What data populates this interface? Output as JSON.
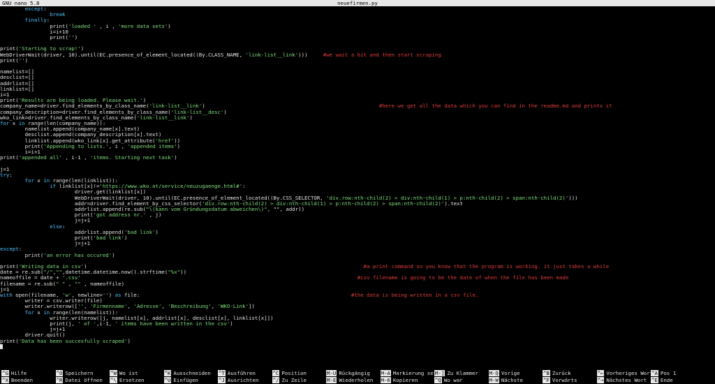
{
  "titlebar": {
    "app": "GNU nano 5.8",
    "filename": "neuefirmen.py"
  },
  "editor": {
    "lines": [
      {
        "y": 0,
        "segs": [
          [
            "n",
            "        "
          ],
          [
            "k",
            "except"
          ],
          [
            "n",
            ":"
          ]
        ]
      },
      {
        "y": 1,
        "segs": [
          [
            "n",
            "                "
          ],
          [
            "k",
            "break"
          ]
        ]
      },
      {
        "y": 2,
        "segs": [
          [
            "n",
            "        "
          ],
          [
            "k",
            "finally"
          ],
          [
            "n",
            ":"
          ]
        ]
      },
      {
        "y": 3,
        "segs": [
          [
            "n",
            "                print("
          ],
          [
            "s",
            "'loaded ' "
          ],
          [
            "n",
            ", i , "
          ],
          [
            "s",
            "'more data sets'"
          ],
          [
            "n",
            ")"
          ]
        ]
      },
      {
        "y": 4,
        "segs": [
          [
            "n",
            "                i=i+10"
          ]
        ]
      },
      {
        "y": 5,
        "segs": [
          [
            "n",
            "                print("
          ],
          [
            "s",
            "''"
          ],
          [
            "n",
            ")"
          ]
        ]
      },
      {
        "y": 7,
        "segs": [
          [
            "n",
            "print("
          ],
          [
            "s",
            "'Starting to scrap!'"
          ],
          [
            "n",
            ")"
          ]
        ]
      },
      {
        "y": 8,
        "segs": [
          [
            "n",
            "WebDriverWait(driver, 10).until(EC.presence_of_element_located((By.CLASS_NAME, "
          ],
          [
            "s",
            "'link-list__link'"
          ],
          [
            "n",
            ")))     "
          ],
          [
            "c",
            "#we wait a bit and then start scraping"
          ]
        ]
      },
      {
        "y": 9,
        "segs": [
          [
            "n",
            "print("
          ],
          [
            "s",
            "''"
          ],
          [
            "n",
            ")"
          ]
        ]
      },
      {
        "y": 11,
        "segs": [
          [
            "n",
            "namelist=[]"
          ]
        ]
      },
      {
        "y": 12,
        "segs": [
          [
            "n",
            "desclist=[]"
          ]
        ]
      },
      {
        "y": 13,
        "segs": [
          [
            "n",
            "addrlist=[]"
          ]
        ]
      },
      {
        "y": 14,
        "segs": [
          [
            "n",
            "linklist=[]"
          ]
        ]
      },
      {
        "y": 15,
        "segs": [
          [
            "n",
            "i=1"
          ]
        ]
      },
      {
        "y": 16,
        "segs": [
          [
            "n",
            "print("
          ],
          [
            "s",
            "'Results are being loaded. Please wait.'"
          ],
          [
            "n",
            ")"
          ]
        ]
      },
      {
        "y": 17,
        "segs": [
          [
            "n",
            "company_name=driver.find_elements_by_class_name("
          ],
          [
            "s",
            "'link-list__link'"
          ],
          [
            "n",
            ")                                                        "
          ],
          [
            "c",
            "#here we get all the data which you can find in the readme.md and prints it"
          ]
        ]
      },
      {
        "y": 18,
        "segs": [
          [
            "n",
            "company_description=driver.find_elements_by_class_name("
          ],
          [
            "s",
            "'link-list__desc'"
          ],
          [
            "n",
            ")"
          ]
        ]
      },
      {
        "y": 19,
        "segs": [
          [
            "n",
            "wko_link=driver.find_elements_by_class_name("
          ],
          [
            "s",
            "'link-list__link'"
          ],
          [
            "n",
            ")"
          ]
        ]
      },
      {
        "y": 20,
        "segs": [
          [
            "k",
            "for"
          ],
          [
            "n",
            " x "
          ],
          [
            "k",
            "in"
          ],
          [
            "n",
            " range(len(company_name)):"
          ]
        ]
      },
      {
        "y": 21,
        "segs": [
          [
            "n",
            "        namelist.append(company_name[x].text)"
          ]
        ]
      },
      {
        "y": 22,
        "segs": [
          [
            "n",
            "        desclist.append(company_description[x].text)"
          ]
        ]
      },
      {
        "y": 23,
        "segs": [
          [
            "n",
            "        linklist.append(wko_link[x].get_attribute("
          ],
          [
            "s",
            "'href'"
          ],
          [
            "n",
            "))"
          ]
        ]
      },
      {
        "y": 24,
        "segs": [
          [
            "n",
            "        print("
          ],
          [
            "s",
            "'Appending to lists.'"
          ],
          [
            "n",
            ", i , "
          ],
          [
            "s",
            "'appended items'"
          ],
          [
            "n",
            ")"
          ]
        ]
      },
      {
        "y": 25,
        "segs": [
          [
            "n",
            "        i=i+1"
          ]
        ]
      },
      {
        "y": 26,
        "segs": [
          [
            "n",
            "print("
          ],
          [
            "s",
            "'appended all'"
          ],
          [
            "n",
            " , i-1 , "
          ],
          [
            "s",
            "'items. Starting next task'"
          ],
          [
            "n",
            ")"
          ]
        ]
      },
      {
        "y": 28,
        "segs": [
          [
            "n",
            "j=1"
          ]
        ]
      },
      {
        "y": 29,
        "segs": [
          [
            "k",
            "try"
          ],
          [
            "n",
            ":"
          ]
        ]
      },
      {
        "y": 30,
        "segs": [
          [
            "n",
            "        "
          ],
          [
            "k",
            "for"
          ],
          [
            "n",
            " x "
          ],
          [
            "k",
            "in"
          ],
          [
            "n",
            " range(len(linklist)):"
          ]
        ]
      },
      {
        "y": 31,
        "segs": [
          [
            "n",
            "                "
          ],
          [
            "k",
            "if"
          ],
          [
            "n",
            " linklist[x]!="
          ],
          [
            "s",
            "'https://www.wko.at/service/neuzugaenge.html#'"
          ],
          [
            "n",
            ":"
          ]
        ]
      },
      {
        "y": 32,
        "segs": [
          [
            "n",
            "                        driver.get(linklist[x])"
          ]
        ]
      },
      {
        "y": 33,
        "segs": [
          [
            "n",
            "                        WebDriverWait(driver, 10).until(EC.presence_of_element_located((By.CSS_SELECTOR, "
          ],
          [
            "s",
            "'div.row:nth-child(2) > div:nth-child(1) > p:nth-child(2) > span:nth-child(2)'"
          ],
          [
            "n",
            ")))"
          ]
        ]
      },
      {
        "y": 34,
        "segs": [
          [
            "n",
            "                        addr=driver.find_element_by_css_selector("
          ],
          [
            "s",
            "'div.row:nth-child(2) > div:nth-child(1) > p:nth-child(2) > span:nth-child(2)'"
          ],
          [
            "n",
            ").text"
          ]
        ]
      },
      {
        "y": 35,
        "segs": [
          [
            "n",
            "                        addrlist.append(re.sub("
          ],
          [
            "s",
            "\"\\(kann vom Gründungsdatum abweichen\\)\""
          ],
          [
            "n",
            ", \"\", addr))"
          ]
        ]
      },
      {
        "y": 36,
        "segs": [
          [
            "n",
            "                        print("
          ],
          [
            "s",
            "'got address nr.'"
          ],
          [
            "n",
            " , j)"
          ]
        ]
      },
      {
        "y": 37,
        "segs": [
          [
            "n",
            "                        j=j+1"
          ]
        ]
      },
      {
        "y": 38,
        "segs": [
          [
            "n",
            "                "
          ],
          [
            "k",
            "else"
          ],
          [
            "n",
            ":"
          ]
        ]
      },
      {
        "y": 39,
        "segs": [
          [
            "n",
            "                        addrlist.append("
          ],
          [
            "s",
            "'bad link'"
          ],
          [
            "n",
            ")"
          ]
        ]
      },
      {
        "y": 40,
        "segs": [
          [
            "n",
            "                        print("
          ],
          [
            "s",
            "'bad link'"
          ],
          [
            "n",
            ")"
          ]
        ]
      },
      {
        "y": 41,
        "segs": [
          [
            "n",
            "                        j=j+1"
          ]
        ]
      },
      {
        "y": 42,
        "segs": [
          [
            "k",
            "except"
          ],
          [
            "n",
            ":"
          ]
        ]
      },
      {
        "y": 43,
        "segs": [
          [
            "n",
            "        print("
          ],
          [
            "s",
            "'an error has occured'"
          ],
          [
            "n",
            ")"
          ]
        ]
      },
      {
        "y": 45,
        "segs": [
          [
            "n",
            "print("
          ],
          [
            "s",
            "'Writing data in csv'"
          ],
          [
            "n",
            ")                                                                                         "
          ],
          [
            "c",
            "#a print command so you know that the program is working. it just takes a while"
          ]
        ]
      },
      {
        "y": 46,
        "segs": [
          [
            "n",
            "date = re.sub("
          ],
          [
            "s",
            "\"/\""
          ],
          [
            "n",
            ","
          ],
          [
            "s",
            "\"\""
          ],
          [
            "n",
            ",datetime.datetime.now().strftime("
          ],
          [
            "s",
            "\"%x\""
          ],
          [
            "n",
            "))"
          ]
        ]
      },
      {
        "y": 47,
        "segs": [
          [
            "n",
            "nameoffile = date + "
          ],
          [
            "s",
            "'.csv'"
          ],
          [
            "n",
            "                                                                                         "
          ],
          [
            "c",
            "#csv filename is going to be the date of when the file has been made"
          ]
        ]
      },
      {
        "y": 48,
        "segs": [
          [
            "n",
            "filename = re.sub("
          ],
          [
            "s",
            "\" \""
          ],
          [
            "n",
            " , "
          ],
          [
            "s",
            "\"\""
          ],
          [
            "n",
            " , nameoffile)"
          ]
        ]
      },
      {
        "y": 49,
        "segs": [
          [
            "n",
            "j=1"
          ]
        ]
      },
      {
        "y": 50,
        "segs": [
          [
            "k",
            "with"
          ],
          [
            "n",
            " open(filename, "
          ],
          [
            "s",
            "'w'"
          ],
          [
            "n",
            ", newline="
          ],
          [
            "s",
            "''"
          ],
          [
            "n",
            ") "
          ],
          [
            "k",
            "as"
          ],
          [
            "n",
            " file:                                                                    "
          ],
          [
            "c",
            "#the data is being written in a csv file."
          ]
        ]
      },
      {
        "y": 51,
        "segs": [
          [
            "n",
            "        writer = csv.writer(file)"
          ]
        ]
      },
      {
        "y": 52,
        "segs": [
          [
            "n",
            "        writer.writerow(["
          ],
          [
            "s",
            "''"
          ],
          [
            "n",
            ", "
          ],
          [
            "s",
            "'Firmenname'"
          ],
          [
            "n",
            ", "
          ],
          [
            "s",
            "'Adresse'"
          ],
          [
            "n",
            ", "
          ],
          [
            "s",
            "'Beschreibung'"
          ],
          [
            "n",
            ", "
          ],
          [
            "s",
            "'WKO-Link'"
          ],
          [
            "n",
            "])"
          ]
        ]
      },
      {
        "y": 53,
        "segs": [
          [
            "n",
            "        "
          ],
          [
            "k",
            "for"
          ],
          [
            "n",
            " x "
          ],
          [
            "k",
            "in"
          ],
          [
            "n",
            " range(len(namelist)):"
          ]
        ]
      },
      {
        "y": 54,
        "segs": [
          [
            "n",
            "                writer.writerow([j, namelist[x], addrlist[x], desclist[x], linklist[x]])"
          ]
        ]
      },
      {
        "y": 55,
        "segs": [
          [
            "n",
            "                print(j, "
          ],
          [
            "s",
            "' of '"
          ],
          [
            "n",
            ",i-1, "
          ],
          [
            "s",
            "' items have been written in the csv'"
          ],
          [
            "n",
            ")"
          ]
        ]
      },
      {
        "y": 56,
        "segs": [
          [
            "n",
            "                j=j+1"
          ]
        ]
      },
      {
        "y": 57,
        "segs": [
          [
            "n",
            "        driver.quit()"
          ]
        ]
      },
      {
        "y": 58,
        "segs": [
          [
            "n",
            "print("
          ],
          [
            "s",
            "'Data has been succesfully scraped'"
          ],
          [
            "n",
            ")"
          ]
        ]
      }
    ]
  },
  "shortcuts": [
    {
      "key": "^G",
      "label": "Hilfe",
      "col": 0,
      "row": 0
    },
    {
      "key": "^X",
      "label": "Beenden",
      "col": 0,
      "row": 1
    },
    {
      "key": "^O",
      "label": "Speichern",
      "col": 1,
      "row": 0
    },
    {
      "key": "^R",
      "label": "Datei öffnen",
      "col": 1,
      "row": 1
    },
    {
      "key": "^W",
      "label": "Wo ist",
      "col": 2,
      "row": 0
    },
    {
      "key": "^\\",
      "label": "Ersetzen",
      "col": 2,
      "row": 1
    },
    {
      "key": "^K",
      "label": "Ausschneiden",
      "col": 3,
      "row": 0
    },
    {
      "key": "^U",
      "label": "Einfügen",
      "col": 3,
      "row": 1
    },
    {
      "key": "^T",
      "label": "Ausführen",
      "col": 4,
      "row": 0
    },
    {
      "key": "^J",
      "label": "Ausrichten",
      "col": 4,
      "row": 1
    },
    {
      "key": "^C",
      "label": "Position",
      "col": 5,
      "row": 0
    },
    {
      "key": "^/",
      "label": "Zu Zeile",
      "col": 5,
      "row": 1
    },
    {
      "key": "M-U",
      "label": "Rückgängig",
      "col": 6,
      "row": 0
    },
    {
      "key": "M-E",
      "label": "Wiederholen",
      "col": 6,
      "row": 1
    },
    {
      "key": "M-A",
      "label": "Markierung set",
      "col": 7,
      "row": 0
    },
    {
      "key": "M-6",
      "label": "Kopieren",
      "col": 7,
      "row": 1
    },
    {
      "key": "M-]",
      "label": "Zu Klammer",
      "col": 8,
      "row": 0
    },
    {
      "key": "^Q",
      "label": "Wo war",
      "col": 8,
      "row": 1
    },
    {
      "key": "M-Q",
      "label": "Vorige",
      "col": 9,
      "row": 0
    },
    {
      "key": "M-W",
      "label": "Nächste",
      "col": 9,
      "row": 1
    },
    {
      "key": "^B",
      "label": "Zurück",
      "col": 10,
      "row": 0
    },
    {
      "key": "^F",
      "label": "Vorwärts",
      "col": 10,
      "row": 1
    },
    {
      "key": "^←",
      "label": "Vorheriges Wort",
      "col": 11,
      "row": 0
    },
    {
      "key": "^→",
      "label": "Nächstes Wort",
      "col": 11,
      "row": 1
    },
    {
      "key": "^A",
      "label": "Pos 1",
      "col": 12,
      "row": 0
    },
    {
      "key": "^E",
      "label": "Ende",
      "col": 12,
      "row": 1
    }
  ],
  "colors": {
    "keyword": "#4fc3ff",
    "string": "#7fe07f",
    "comment": "#e23b3b",
    "text": "#e6e6e6",
    "background": "#000000",
    "bar": "#e8e8e8"
  }
}
